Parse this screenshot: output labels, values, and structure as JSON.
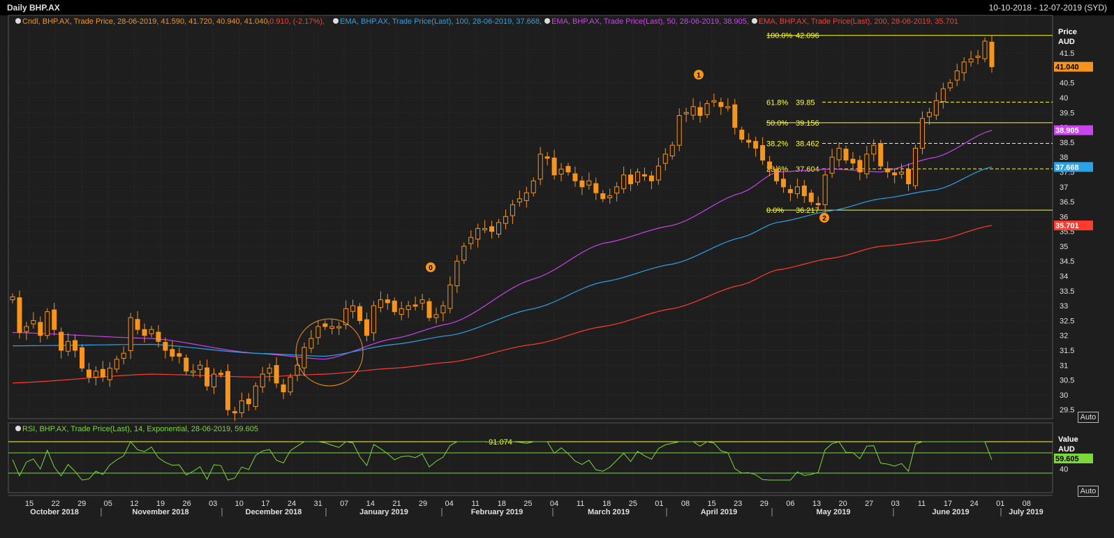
{
  "window": {
    "title": "Daily BHP.AX",
    "date_range": "10-10-2018 - 12-07-2019 (SYD)"
  },
  "legend": {
    "candle": {
      "label": "Cndl, BHP.AX, Trade Price, 28-06-2019, 41.590, 41.720, 40.940, 41.040,",
      "change": "-0.910, (-2.17%),",
      "color": "#f7941d",
      "change_color": "#ff3b2f"
    },
    "ema100": {
      "label": "EMA, BHP.AX, Trade Price(Last),  100, 28-06-2019, 37.668,",
      "color": "#29a3e8"
    },
    "ema50": {
      "label": "EMA, BHP.AX, Trade Price(Last),  50, 28-06-2019, 38.905,",
      "color": "#cc44ee"
    },
    "ema200": {
      "label": "EMA, BHP.AX, Trade Price(Last),  200, 28-06-2019, 35.701",
      "color": "#ff3b2f"
    }
  },
  "rsi_legend": {
    "label": "RSI, BHP.AX, Trade Price(Last),  14, Exponential,  28-06-2019, 59.605",
    "color": "#7cd83a"
  },
  "axis": {
    "price_header": "Price",
    "currency": "AUD",
    "auto_label": "Auto",
    "rsi_header": "Value",
    "rsi_currency": "AUD",
    "rsi_auto_label": "Auto",
    "price_ticks": [
      "29.5",
      "30",
      "30.5",
      "31",
      "31.5",
      "32",
      "32.5",
      "33",
      "33.5",
      "34",
      "34.5",
      "35",
      "35.5",
      "36",
      "36.5",
      "37",
      "37.5",
      "38",
      "38.5",
      "39",
      "39.5",
      "40",
      "40.5",
      "41.5"
    ],
    "rsi_tick": "40",
    "day_labels": [
      "15",
      "22",
      "29",
      "05",
      "12",
      "19",
      "26",
      "03",
      "10",
      "17",
      "24",
      "31",
      "07",
      "14",
      "21",
      "29",
      "04",
      "11",
      "18",
      "25",
      "04",
      "11",
      "18",
      "25",
      "01",
      "08",
      "15",
      "23",
      "29",
      "06",
      "13",
      "20",
      "27",
      "03",
      "11",
      "17",
      "24",
      "01",
      "08"
    ],
    "month_labels": [
      "October 2018",
      "November 2018",
      "December 2018",
      "January 2019",
      "February 2019",
      "March 2019",
      "April 2019",
      "May 2019",
      "June 2019",
      "July 2019"
    ]
  },
  "badges": {
    "last_price": "41.040",
    "ema50": "38.905",
    "ema100": "37.668",
    "ema200": "35.701",
    "rsi": "59.605"
  },
  "fibonacci": [
    {
      "pct": "100.0%",
      "value": "42.096",
      "price": 42.096,
      "style": "solid"
    },
    {
      "pct": "61.8%",
      "value": "39.85",
      "price": 39.85,
      "style": "dashed"
    },
    {
      "pct": "50.0%",
      "value": "39.156",
      "price": 39.156,
      "style": "solid"
    },
    {
      "pct": "38.2%",
      "value": "38.462",
      "price": 38.462,
      "style": "dashed"
    },
    {
      "pct": "23.6%",
      "value": "37.604",
      "price": 37.604,
      "style": "dashed"
    },
    {
      "pct": "0.0%",
      "value": "36.217",
      "price": 36.217,
      "style": "solid"
    }
  ],
  "rsi_max_label": "91.074",
  "markers": [
    "0",
    "1",
    "2"
  ],
  "chart_data": {
    "type": "candlestick",
    "title": "Daily BHP.AX",
    "ylabel": "Price AUD",
    "ylim": [
      29.2,
      42.3
    ],
    "grid": true,
    "closes": [
      33.3,
      32.1,
      32.3,
      32.5,
      32.0,
      32.8,
      32.2,
      31.5,
      31.8,
      31.5,
      30.9,
      30.6,
      30.8,
      30.6,
      30.9,
      31.2,
      31.4,
      32.6,
      32.2,
      32.0,
      32.2,
      31.8,
      31.5,
      31.3,
      31.3,
      30.8,
      30.8,
      31.0,
      30.3,
      30.7,
      30.7,
      29.5,
      29.4,
      29.8,
      29.7,
      30.3,
      30.7,
      30.9,
      30.4,
      30.1,
      30.6,
      31.0,
      31.6,
      31.9,
      32.3,
      32.3,
      32.3,
      32.3,
      32.9,
      33.0,
      32.5,
      32.0,
      33.0,
      33.2,
      33.1,
      32.8,
      32.9,
      33.0,
      33.0,
      33.2,
      32.6,
      32.7,
      33.0,
      33.7,
      34.5,
      35.0,
      35.3,
      35.6,
      35.6,
      35.5,
      35.8,
      36.0,
      36.4,
      36.6,
      36.8,
      37.2,
      38.1,
      38.0,
      37.4,
      37.6,
      37.5,
      37.2,
      37.0,
      37.2,
      36.8,
      36.6,
      36.7,
      37.0,
      37.4,
      37.1,
      37.5,
      37.4,
      37.2,
      37.7,
      38.1,
      38.4,
      39.4,
      39.5,
      39.7,
      39.4,
      39.8,
      39.9,
      39.7,
      39.7,
      39.0,
      38.6,
      38.5,
      38.3,
      37.9,
      37.6,
      37.2,
      37.0,
      36.8,
      37.0,
      36.7,
      36.5,
      36.4,
      37.4,
      38.0,
      38.3,
      37.9,
      37.8,
      37.5,
      38.1,
      38.4,
      37.7,
      37.5,
      37.4,
      37.5,
      37.1,
      38.3,
      39.3,
      39.5,
      39.9,
      40.3,
      40.5,
      40.9,
      41.2,
      41.3,
      41.4,
      41.9,
      41.04
    ],
    "series": [
      {
        "name": "EMA 50",
        "points": [
          [
            0,
            32.1
          ],
          [
            20,
            31.9
          ],
          [
            35,
            31.4
          ],
          [
            45,
            31.2
          ],
          [
            55,
            31.9
          ],
          [
            63,
            32.4
          ],
          [
            75,
            33.9
          ],
          [
            85,
            35.1
          ],
          [
            95,
            35.7
          ],
          [
            105,
            36.8
          ],
          [
            110,
            37.5
          ],
          [
            118,
            37.6
          ],
          [
            125,
            37.5
          ],
          [
            133,
            38.0
          ],
          [
            141,
            38.9
          ]
        ]
      },
      {
        "name": "EMA 100",
        "points": [
          [
            0,
            31.65
          ],
          [
            20,
            31.7
          ],
          [
            35,
            31.4
          ],
          [
            45,
            31.3
          ],
          [
            55,
            31.7
          ],
          [
            63,
            32.0
          ],
          [
            75,
            32.9
          ],
          [
            85,
            33.8
          ],
          [
            95,
            34.4
          ],
          [
            105,
            35.3
          ],
          [
            110,
            35.8
          ],
          [
            118,
            36.2
          ],
          [
            125,
            36.6
          ],
          [
            133,
            36.9
          ],
          [
            141,
            37.67
          ]
        ]
      },
      {
        "name": "EMA 200",
        "points": [
          [
            0,
            30.4
          ],
          [
            20,
            30.7
          ],
          [
            35,
            30.6
          ],
          [
            45,
            30.7
          ],
          [
            55,
            30.9
          ],
          [
            63,
            31.1
          ],
          [
            75,
            31.7
          ],
          [
            85,
            32.3
          ],
          [
            95,
            32.9
          ],
          [
            105,
            33.7
          ],
          [
            110,
            34.2
          ],
          [
            118,
            34.6
          ],
          [
            125,
            35.0
          ],
          [
            133,
            35.2
          ],
          [
            141,
            35.7
          ]
        ]
      }
    ],
    "rsi": {
      "min": 0,
      "max": 100,
      "last": 59.605,
      "levels": [
        91.074,
        70,
        40
      ]
    }
  }
}
